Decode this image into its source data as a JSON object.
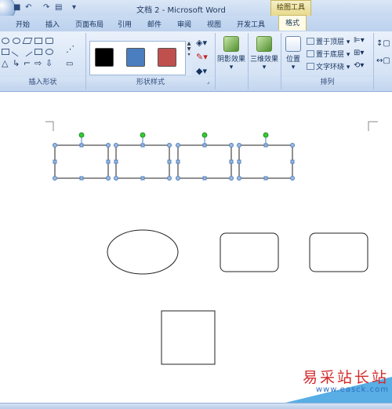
{
  "window": {
    "title": "文档 2 - Microsoft Word",
    "context_tab": "绘图工具"
  },
  "tabs": [
    "开始",
    "插入",
    "页面布局",
    "引用",
    "邮件",
    "审阅",
    "视图",
    "开发工具",
    "格式"
  ],
  "active_tab": "格式",
  "ribbon": {
    "groups": {
      "insert_shapes": "插入形状",
      "shape_styles": "形状样式",
      "arrange": "排列"
    },
    "shape_style_swatches": [
      "#000000",
      "#4a7ebf",
      "#c0504d"
    ],
    "buttons": {
      "shadow_effects": "阴影效果",
      "3d_effects": "三维效果",
      "position": "位置",
      "bring_to_front": "置于顶层",
      "send_to_back": "置于底层",
      "text_wrapping": "文字环绕"
    }
  },
  "watermark": {
    "text": "易采站长站",
    "url": "www.easck.com"
  },
  "colors": {
    "handle_blue": "#4f81bd",
    "rotate_handle_green": "#33cc33",
    "watermark_red": "#d42b2b"
  }
}
